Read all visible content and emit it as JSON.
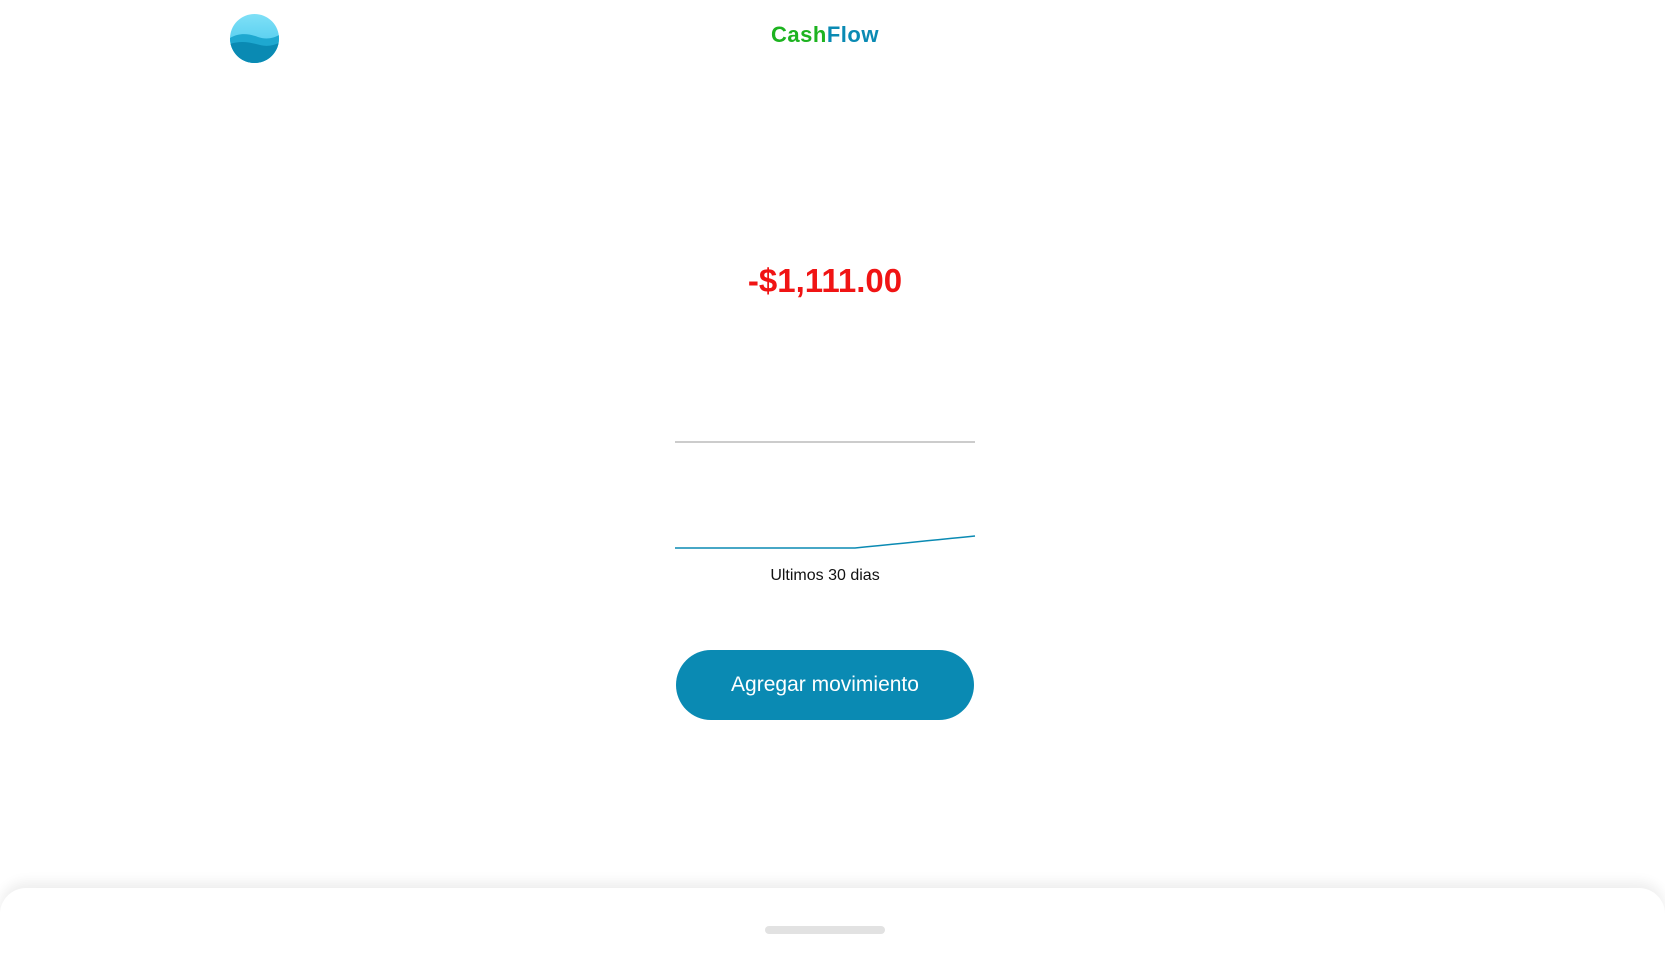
{
  "header": {
    "logo_icon": "wave-globe-icon",
    "brand_part1": "Cash",
    "brand_part2": "Flow",
    "brand_colors": {
      "cash": "#1db320",
      "flow": "#0a8ab3"
    }
  },
  "summary": {
    "balance": "-$1,111.00",
    "balance_color": "#f01414"
  },
  "chart_data": {
    "type": "line",
    "series": [
      {
        "values": [
          0,
          0,
          0,
          0,
          0,
          0,
          0,
          0,
          0,
          0,
          0,
          0,
          0,
          0,
          0,
          0,
          1,
          2,
          3,
          4,
          5,
          6,
          7,
          8,
          9,
          10
        ]
      }
    ],
    "reference_line": true,
    "line_color": "#0a8ab3",
    "reference_color": "#cccccc",
    "caption": "Ultimos 30 dias"
  },
  "actions": {
    "add_label": "Agregar movimiento",
    "add_color": "#0a8ab3"
  },
  "bottom_sheet": {
    "handle_icon": "drag-handle-icon"
  }
}
